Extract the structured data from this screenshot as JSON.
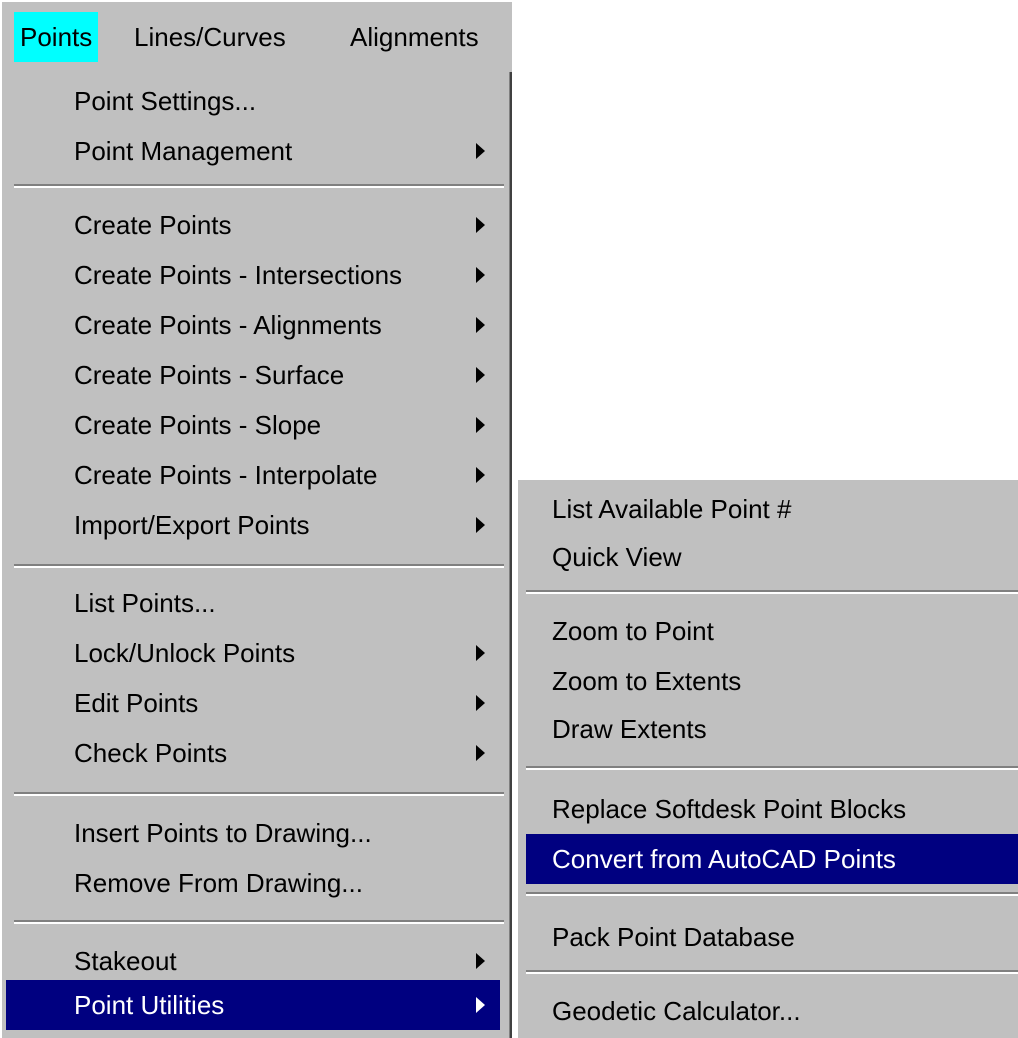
{
  "menubar": {
    "items": [
      {
        "label": "Points",
        "active": true
      },
      {
        "label": "Lines/Curves",
        "active": false
      },
      {
        "label": "Alignments",
        "active": false
      }
    ]
  },
  "points_menu": {
    "groups": [
      [
        {
          "label": "Point Settings...",
          "has_submenu": false
        },
        {
          "label": "Point Management",
          "has_submenu": true
        }
      ],
      [
        {
          "label": "Create Points",
          "has_submenu": true
        },
        {
          "label": "Create Points - Intersections",
          "has_submenu": true
        },
        {
          "label": "Create Points - Alignments",
          "has_submenu": true
        },
        {
          "label": "Create Points - Surface",
          "has_submenu": true
        },
        {
          "label": "Create Points - Slope",
          "has_submenu": true
        },
        {
          "label": "Create Points - Interpolate",
          "has_submenu": true
        },
        {
          "label": "Import/Export Points",
          "has_submenu": true
        }
      ],
      [
        {
          "label": "List Points...",
          "has_submenu": false
        },
        {
          "label": "Lock/Unlock Points",
          "has_submenu": true
        },
        {
          "label": "Edit Points",
          "has_submenu": true
        },
        {
          "label": "Check Points",
          "has_submenu": true
        }
      ],
      [
        {
          "label": "Insert Points to Drawing...",
          "has_submenu": false
        },
        {
          "label": "Remove From Drawing...",
          "has_submenu": false
        }
      ],
      [
        {
          "label": "Stakeout",
          "has_submenu": true
        },
        {
          "label": "Point Utilities",
          "has_submenu": true,
          "highlighted": true
        }
      ]
    ]
  },
  "point_utilities_submenu": {
    "groups": [
      [
        {
          "label": "List Available Point #"
        },
        {
          "label": "Quick View"
        }
      ],
      [
        {
          "label": "Zoom to Point"
        },
        {
          "label": "Zoom to Extents"
        },
        {
          "label": "Draw Extents"
        }
      ],
      [
        {
          "label": "Replace Softdesk Point Blocks"
        },
        {
          "label": "Convert from AutoCAD Points",
          "highlighted": true
        }
      ],
      [
        {
          "label": "Pack Point Database"
        }
      ],
      [
        {
          "label": "Geodetic Calculator..."
        }
      ]
    ]
  },
  "colors": {
    "menu_face": "#c0c0c0",
    "highlight": "#000080",
    "active_bar_item": "#00ffff",
    "highlight_text": "#ffffff"
  }
}
